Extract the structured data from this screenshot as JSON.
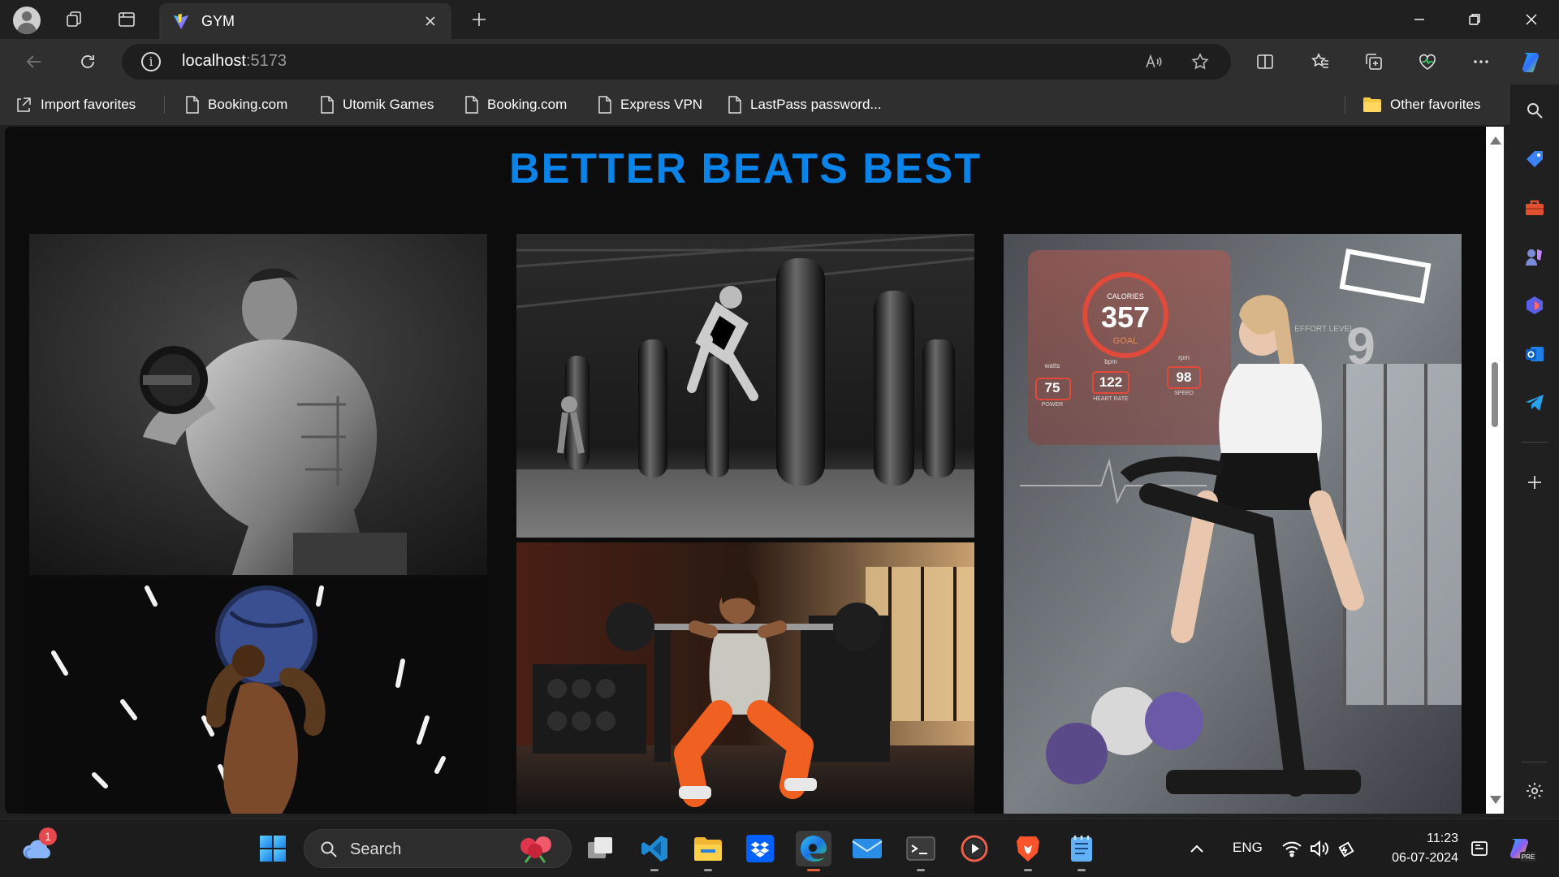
{
  "browser": {
    "tab": {
      "title": "GYM",
      "favicon": "vite-icon"
    },
    "address": {
      "host": "localhost",
      "port": ":5173"
    },
    "favorites": [
      {
        "label": "Import favorites",
        "icon": "import-icon"
      },
      {
        "label": "Booking.com",
        "icon": "page-icon"
      },
      {
        "label": "Utomik Games",
        "icon": "page-icon"
      },
      {
        "label": "Booking.com",
        "icon": "page-icon"
      },
      {
        "label": "Express VPN",
        "icon": "page-icon"
      },
      {
        "label": "LastPass password...",
        "icon": "page-icon"
      }
    ],
    "other_favorites": "Other favorites"
  },
  "page": {
    "title": "BETTER BEATS BEST",
    "gallery": [
      {
        "name": "muscular man with dumbbell"
      },
      {
        "name": "man kicking punching bag in boxing gym"
      },
      {
        "name": "woman on exercise bike with holographic stats"
      },
      {
        "name": "man lifting medicine ball"
      },
      {
        "name": "woman doing barbell lunge"
      }
    ],
    "hud": {
      "calories_label": "CALORIES",
      "calories": "357",
      "goal": "GOAL",
      "effort_label": "EFFORT LEVEL",
      "effort": "9",
      "stats": [
        {
          "unit": "watts",
          "value": "75",
          "label": "POWER"
        },
        {
          "unit": "bpm",
          "value": "122",
          "label": "HEART RATE"
        },
        {
          "unit": "rpm",
          "value": "98",
          "label": "SPEED"
        }
      ]
    }
  },
  "taskbar": {
    "search_label": "Search",
    "weather_badge": "1",
    "language": "ENG",
    "time": "11:23",
    "date": "06-07-2024"
  },
  "colors": {
    "accent": "#0a84e8",
    "page_bg": "#0c0c0c",
    "chrome": "#2f2f2f"
  }
}
